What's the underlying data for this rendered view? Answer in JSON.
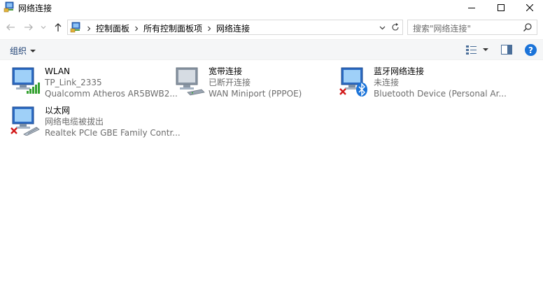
{
  "window": {
    "title": "网络连接"
  },
  "address": {
    "crumbs": [
      "控制面板",
      "所有控制面板项",
      "网络连接"
    ],
    "search_placeholder": "搜索\"网络连接\""
  },
  "toolbar": {
    "organize_label": "组织"
  },
  "connections": [
    {
      "name": "WLAN",
      "status": "TP_Link_2335",
      "device": "Qualcomm Atheros AR5BWB2...",
      "icon": "wifi-adapter-icon"
    },
    {
      "name": "宽带连接",
      "status": "已断开连接",
      "device": "WAN Miniport (PPPOE)",
      "icon": "broadband-modem-icon"
    },
    {
      "name": "蓝牙网络连接",
      "status": "未连接",
      "device": "Bluetooth Device (Personal Ar...",
      "icon": "bluetooth-adapter-icon"
    },
    {
      "name": "以太网",
      "status": "网络电缆被拔出",
      "device": "Realtek PCIe GBE Family Contr...",
      "icon": "ethernet-adapter-icon"
    }
  ],
  "colors": {
    "accent": "#1a73d9",
    "signal": "#35a131",
    "error": "#d21a1a",
    "bluetooth": "#1a73d9"
  }
}
